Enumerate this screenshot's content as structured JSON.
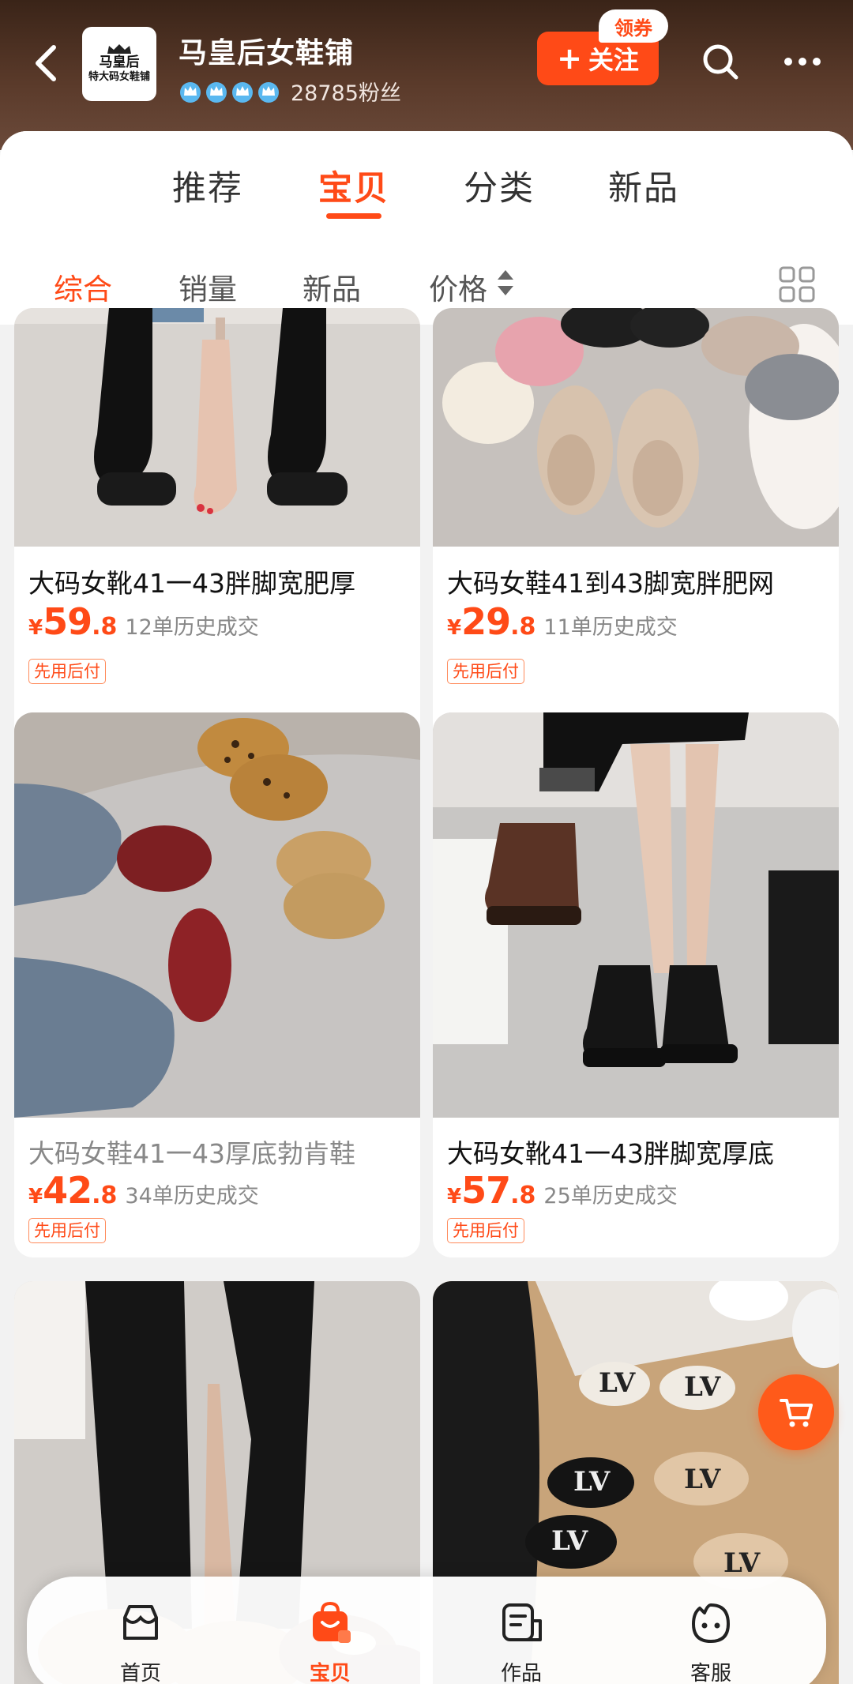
{
  "header": {
    "shop_logo_line1": "马皇后",
    "shop_logo_line2": "特大码女鞋铺",
    "shop_name": "马皇后女鞋铺",
    "fans": "28785粉丝",
    "follow_label": "关注",
    "coupon_label": "领券"
  },
  "tabs": [
    "推荐",
    "宝贝",
    "分类",
    "新品"
  ],
  "sort": {
    "items": [
      "综合",
      "销量",
      "新品",
      "价格"
    ]
  },
  "products": [
    {
      "title": "大码女靴41一43胖脚宽肥厚",
      "currency": "¥",
      "price_int": "59",
      "price_dec": ".8",
      "sold": "12单历史成交",
      "tag": "先用后付"
    },
    {
      "title": "大码女鞋41到43脚宽胖肥网",
      "currency": "¥",
      "price_int": "29",
      "price_dec": ".8",
      "sold": "11单历史成交",
      "tag": "先用后付"
    },
    {
      "title": "大码女鞋41一43厚底勃肯鞋",
      "currency": "¥",
      "price_int": "42",
      "price_dec": ".8",
      "sold": "34单历史成交",
      "tag": "先用后付"
    },
    {
      "title": "大码女靴41一43胖脚宽厚底",
      "currency": "¥",
      "price_int": "57",
      "price_dec": ".8",
      "sold": "25单历史成交",
      "tag": "先用后付"
    }
  ],
  "bottom_nav": [
    "首页",
    "宝贝",
    "作品",
    "客服"
  ],
  "colors": {
    "accent": "#ff4a17",
    "header_bg": "#4a2e20"
  },
  "icons": [
    "back-arrow-icon",
    "crown-icon",
    "search-icon",
    "more-icon",
    "sort-arrows-icon",
    "grid-icon",
    "cart-icon",
    "home-icon",
    "bag-icon",
    "works-icon",
    "service-icon"
  ]
}
